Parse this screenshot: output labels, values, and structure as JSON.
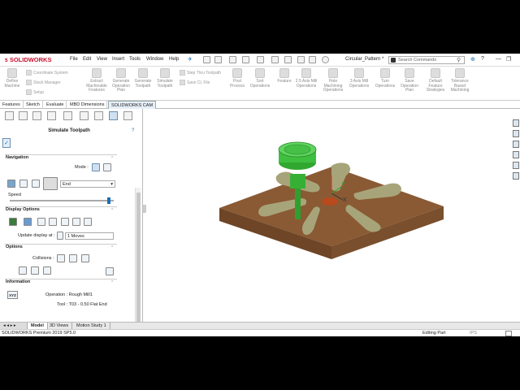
{
  "app": {
    "logo": "SOLIDWORKS",
    "document": "Circular_Pattern *"
  },
  "menu": [
    "File",
    "Edit",
    "View",
    "Insert",
    "Tools",
    "Window",
    "Help"
  ],
  "search": {
    "placeholder": "Search Commands"
  },
  "ribbon": {
    "left_buttons": [
      {
        "label": "Define Machine"
      },
      {
        "label": "Extract Machinable Features"
      },
      {
        "label": "Generate Operation Plan"
      },
      {
        "label": "Generate Toolpath"
      },
      {
        "label": "Simulate Toolpath"
      }
    ],
    "small_items": [
      "Coordinate System",
      "Stock Manager",
      "Setup",
      "Step Thru Toolpath",
      "Save CL File"
    ],
    "right_buttons": [
      {
        "label": "Post Process"
      },
      {
        "label": "Sort Operations"
      },
      {
        "label": "Feature"
      },
      {
        "label": "2.5 Axis Mill Operations"
      },
      {
        "label": "Hole Machining Operations"
      },
      {
        "label": "3 Axis Mill Operations"
      },
      {
        "label": "Turn Operations"
      },
      {
        "label": "Save Operation Plan"
      },
      {
        "label": "Default Feature Strategies"
      },
      {
        "label": "Tolerance Based Machining"
      }
    ]
  },
  "tabs": [
    "Features",
    "Sketch",
    "Evaluate",
    "MBD Dimensions",
    "SOLIDWORKS CAM"
  ],
  "panel": {
    "title": "Simulate Toolpath",
    "help": "?",
    "navigation": {
      "header": "Navigation",
      "mode_label": "Mode :",
      "end_value": "End",
      "speed_label": "Speed",
      "speed_level": 0.95
    },
    "display": {
      "header": "Display Options",
      "update_label": "Update display at :",
      "update_value": "1 Moves"
    },
    "options": {
      "header": "Options",
      "collisions_label": "Collisions :"
    },
    "information": {
      "header": "Information",
      "xyz": "XYZ",
      "operation": "Operation :  Rough Mill1",
      "tool": "Tool :  T03 - 0.50 Flat End"
    }
  },
  "bottom_tabs": [
    "Model",
    "3D Views",
    "Motion Study 1"
  ],
  "status": {
    "left": "SOLIDWORKS Premium 2019 SP5.0",
    "mode": "Editing Part",
    "units": "IPS"
  },
  "colors": {
    "stock": "#8a5a34",
    "tool": "#3fbf3f",
    "brand": "#c8102e",
    "pocket": "#a8a47a"
  }
}
